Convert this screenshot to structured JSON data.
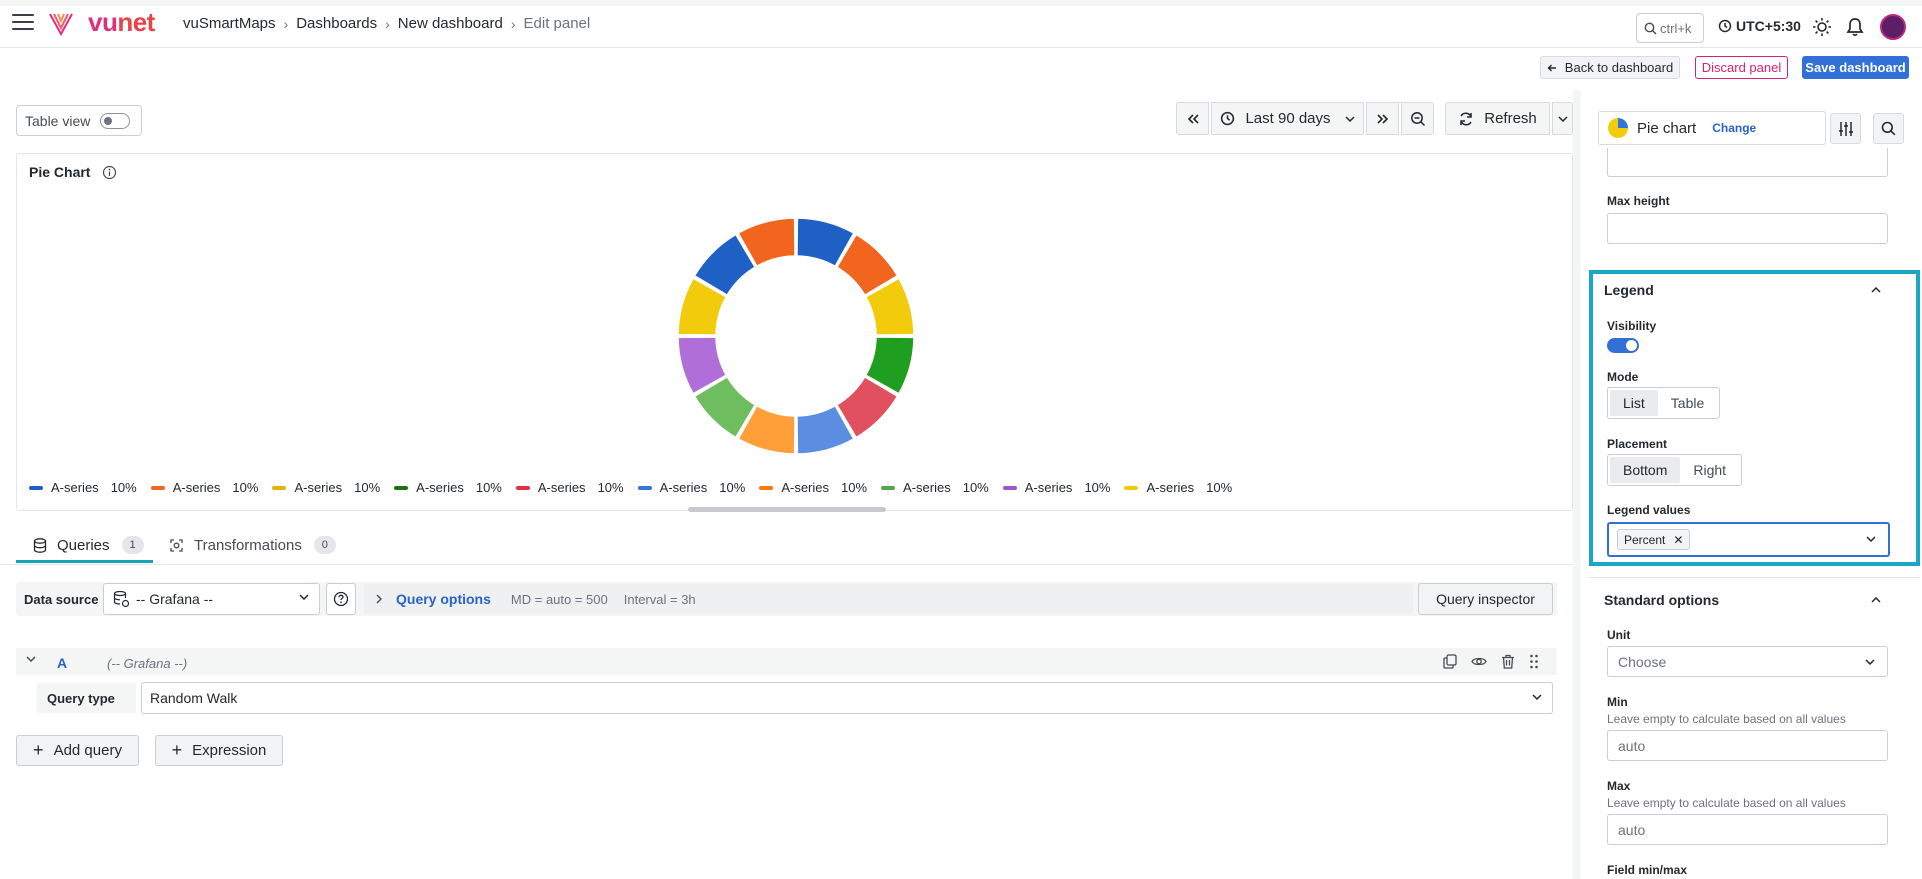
{
  "brand": {
    "logo_vu": "vu",
    "logo_net": "net"
  },
  "breadcrumbs": [
    "vuSmartMaps",
    "Dashboards",
    "New dashboard",
    "Edit panel"
  ],
  "topbar": {
    "search_placeholder": "ctrl+k",
    "timezone": "UTC+5:30"
  },
  "actions": {
    "back": "Back to dashboard",
    "discard": "Discard panel",
    "save": "Save dashboard"
  },
  "toolbar": {
    "table_view": "Table view",
    "time_range": "Last 90 days",
    "refresh": "Refresh"
  },
  "panel": {
    "title": "Pie Chart",
    "legend": [
      {
        "name": "A-series",
        "value": "10%",
        "color": "#1f60c4"
      },
      {
        "name": "A-series",
        "value": "10%",
        "color": "#f2651e"
      },
      {
        "name": "A-series",
        "value": "10%",
        "color": "#e0b400"
      },
      {
        "name": "A-series",
        "value": "10%",
        "color": "#19730e"
      },
      {
        "name": "A-series",
        "value": "10%",
        "color": "#e02f44"
      },
      {
        "name": "A-series",
        "value": "10%",
        "color": "#3274d9"
      },
      {
        "name": "A-series",
        "value": "10%",
        "color": "#ff780a"
      },
      {
        "name": "A-series",
        "value": "10%",
        "color": "#56a64b"
      },
      {
        "name": "A-series",
        "value": "10%",
        "color": "#a352cc"
      },
      {
        "name": "A-series",
        "value": "10%",
        "color": "#f2cc0c"
      }
    ]
  },
  "chart_data": {
    "type": "pie",
    "donut": true,
    "categories": [
      "A-series",
      "A-series",
      "A-series",
      "A-series",
      "A-series",
      "A-series",
      "A-series",
      "A-series",
      "A-series",
      "A-series",
      "A-series",
      "A-series"
    ],
    "values": [
      10,
      10,
      10,
      10,
      10,
      10,
      10,
      10,
      10,
      10,
      10,
      10
    ],
    "colors": [
      "#1f60c4",
      "#f2651e",
      "#f2cc0c",
      "#1f9e1f",
      "#e0505e",
      "#5b8de0",
      "#ff9f3a",
      "#6ebd5e",
      "#b06ed8",
      "#f2cc0c",
      "#1f60c4",
      "#f2651e"
    ],
    "legend_placement": "bottom"
  },
  "tabs": [
    {
      "label": "Queries",
      "count": "1"
    },
    {
      "label": "Transformations",
      "count": "0"
    }
  ],
  "query": {
    "ds_label": "Data source",
    "ds_value": "-- Grafana --",
    "options_title": "Query options",
    "options_md": "MD = auto = 500",
    "options_interval": "Interval = 3h",
    "inspector": "Query inspector",
    "ref": "A",
    "ref_ds": "(-- Grafana --)",
    "type_label": "Query type",
    "type_value": "Random Walk",
    "add_query": "Add query",
    "expression": "Expression"
  },
  "options": {
    "viz_name": "Pie chart",
    "viz_change": "Change",
    "max_height_label": "Max height",
    "legend": {
      "title": "Legend",
      "visibility_label": "Visibility",
      "mode_label": "Mode",
      "mode_options": [
        "List",
        "Table"
      ],
      "placement_label": "Placement",
      "placement_options": [
        "Bottom",
        "Right"
      ],
      "values_label": "Legend values",
      "values_chip": "Percent"
    },
    "standard": {
      "title": "Standard options",
      "unit_label": "Unit",
      "unit_placeholder": "Choose",
      "min_label": "Min",
      "min_desc": "Leave empty to calculate based on all values",
      "min_placeholder": "auto",
      "max_label": "Max",
      "max_desc": "Leave empty to calculate based on all values",
      "max_placeholder": "auto",
      "field_minmax_label": "Field min/max"
    }
  }
}
